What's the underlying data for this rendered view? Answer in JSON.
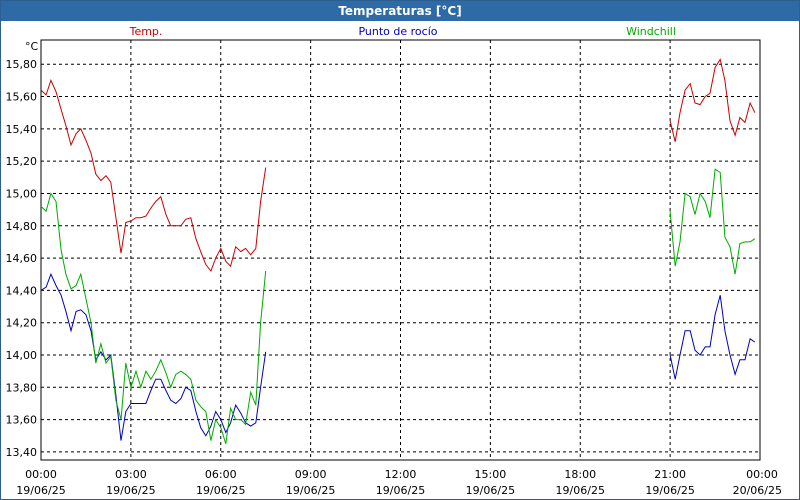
{
  "window": {
    "title": "Temperaturas [°C]"
  },
  "colors": {
    "temp": "#cc0000",
    "dew": "#0000bb",
    "wind": "#00aa00",
    "title_bg": "#2e6aa5"
  },
  "chart_data": {
    "type": "line",
    "title": "Temperaturas [°C]",
    "ylabel": "°C",
    "ylim": [
      13.35,
      15.95
    ],
    "xlim_hours": [
      0,
      24
    ],
    "grid": true,
    "legend_placement": "top",
    "y_ticks": [
      "13,40",
      "13,60",
      "13,80",
      "14,00",
      "14,20",
      "14,40",
      "14,60",
      "14,80",
      "15,00",
      "15,20",
      "15,40",
      "15,60",
      "15,80"
    ],
    "x_ticks": [
      {
        "time": "00:00",
        "date": "19/06/25"
      },
      {
        "time": "03:00",
        "date": "19/06/25"
      },
      {
        "time": "06:00",
        "date": "19/06/25"
      },
      {
        "time": "09:00",
        "date": "19/06/25"
      },
      {
        "time": "12:00",
        "date": "19/06/25"
      },
      {
        "time": "15:00",
        "date": "19/06/25"
      },
      {
        "time": "18:00",
        "date": "19/06/25"
      },
      {
        "time": "21:00",
        "date": "19/06/25"
      },
      {
        "time": "00:00",
        "date": "20/06/25"
      }
    ],
    "series": [
      {
        "name": "Temp.",
        "color": "#cc0000",
        "segments": [
          [
            [
              0.0,
              15.64
            ],
            [
              0.17,
              15.61
            ],
            [
              0.33,
              15.7
            ],
            [
              0.5,
              15.63
            ],
            [
              0.67,
              15.52
            ],
            [
              0.83,
              15.42
            ],
            [
              1.0,
              15.3
            ],
            [
              1.17,
              15.37
            ],
            [
              1.33,
              15.4
            ],
            [
              1.5,
              15.33
            ],
            [
              1.67,
              15.25
            ],
            [
              1.83,
              15.12
            ],
            [
              2.0,
              15.08
            ],
            [
              2.17,
              15.11
            ],
            [
              2.33,
              15.07
            ],
            [
              2.5,
              14.85
            ],
            [
              2.67,
              14.63
            ],
            [
              2.83,
              14.82
            ],
            [
              3.0,
              14.83
            ],
            [
              3.17,
              14.85
            ],
            [
              3.33,
              14.85
            ],
            [
              3.5,
              14.86
            ],
            [
              3.67,
              14.91
            ],
            [
              3.83,
              14.95
            ],
            [
              4.0,
              14.98
            ],
            [
              4.17,
              14.87
            ],
            [
              4.33,
              14.8
            ],
            [
              4.5,
              14.8
            ],
            [
              4.67,
              14.8
            ],
            [
              4.83,
              14.84
            ],
            [
              5.0,
              14.85
            ],
            [
              5.17,
              14.72
            ],
            [
              5.33,
              14.64
            ],
            [
              5.5,
              14.56
            ],
            [
              5.67,
              14.52
            ],
            [
              5.83,
              14.6
            ],
            [
              6.0,
              14.66
            ],
            [
              6.17,
              14.58
            ],
            [
              6.33,
              14.55
            ],
            [
              6.5,
              14.67
            ],
            [
              6.67,
              14.64
            ],
            [
              6.83,
              14.66
            ],
            [
              7.0,
              14.62
            ],
            [
              7.17,
              14.66
            ],
            [
              7.33,
              14.95
            ],
            [
              7.5,
              15.16
            ]
          ],
          [
            [
              21.0,
              15.45
            ],
            [
              21.17,
              15.32
            ],
            [
              21.33,
              15.5
            ],
            [
              21.5,
              15.64
            ],
            [
              21.67,
              15.68
            ],
            [
              21.83,
              15.56
            ],
            [
              22.0,
              15.55
            ],
            [
              22.17,
              15.6
            ],
            [
              22.33,
              15.62
            ],
            [
              22.5,
              15.78
            ],
            [
              22.67,
              15.83
            ],
            [
              22.83,
              15.7
            ],
            [
              23.0,
              15.45
            ],
            [
              23.17,
              15.36
            ],
            [
              23.33,
              15.47
            ],
            [
              23.5,
              15.44
            ],
            [
              23.67,
              15.56
            ],
            [
              23.83,
              15.5
            ]
          ]
        ]
      },
      {
        "name": "Punto de rocío",
        "color": "#0000bb",
        "segments": [
          [
            [
              0.0,
              14.4
            ],
            [
              0.17,
              14.42
            ],
            [
              0.33,
              14.5
            ],
            [
              0.5,
              14.43
            ],
            [
              0.67,
              14.37
            ],
            [
              0.83,
              14.27
            ],
            [
              1.0,
              14.15
            ],
            [
              1.17,
              14.27
            ],
            [
              1.33,
              14.28
            ],
            [
              1.5,
              14.25
            ],
            [
              1.67,
              14.15
            ],
            [
              1.83,
              13.97
            ],
            [
              2.0,
              14.02
            ],
            [
              2.17,
              13.97
            ],
            [
              2.33,
              14.0
            ],
            [
              2.5,
              13.75
            ],
            [
              2.67,
              13.47
            ],
            [
              2.83,
              13.65
            ],
            [
              3.0,
              13.7
            ],
            [
              3.17,
              13.7
            ],
            [
              3.33,
              13.7
            ],
            [
              3.5,
              13.7
            ],
            [
              3.67,
              13.78
            ],
            [
              3.83,
              13.85
            ],
            [
              4.0,
              13.85
            ],
            [
              4.17,
              13.78
            ],
            [
              4.33,
              13.72
            ],
            [
              4.5,
              13.7
            ],
            [
              4.67,
              13.73
            ],
            [
              4.83,
              13.8
            ],
            [
              5.0,
              13.78
            ],
            [
              5.17,
              13.65
            ],
            [
              5.33,
              13.55
            ],
            [
              5.5,
              13.5
            ],
            [
              5.67,
              13.56
            ],
            [
              5.83,
              13.65
            ],
            [
              6.0,
              13.6
            ],
            [
              6.17,
              13.52
            ],
            [
              6.33,
              13.58
            ],
            [
              6.5,
              13.69
            ],
            [
              6.67,
              13.64
            ],
            [
              6.83,
              13.58
            ],
            [
              7.0,
              13.56
            ],
            [
              7.17,
              13.58
            ],
            [
              7.33,
              13.8
            ],
            [
              7.5,
              14.02
            ]
          ],
          [
            [
              21.0,
              14.0
            ],
            [
              21.17,
              13.85
            ],
            [
              21.33,
              14.0
            ],
            [
              21.5,
              14.15
            ],
            [
              21.67,
              14.15
            ],
            [
              21.83,
              14.03
            ],
            [
              22.0,
              14.0
            ],
            [
              22.17,
              14.05
            ],
            [
              22.33,
              14.05
            ],
            [
              22.5,
              14.25
            ],
            [
              22.67,
              14.37
            ],
            [
              22.83,
              14.15
            ],
            [
              23.0,
              14.0
            ],
            [
              23.17,
              13.88
            ],
            [
              23.33,
              13.97
            ],
            [
              23.5,
              13.97
            ],
            [
              23.67,
              14.1
            ],
            [
              23.83,
              14.08
            ]
          ]
        ]
      },
      {
        "name": "Windchill",
        "color": "#00aa00",
        "segments": [
          [
            [
              0.0,
              14.92
            ],
            [
              0.17,
              14.89
            ],
            [
              0.33,
              15.0
            ],
            [
              0.5,
              14.95
            ],
            [
              0.67,
              14.65
            ],
            [
              0.83,
              14.5
            ],
            [
              1.0,
              14.41
            ],
            [
              1.17,
              14.43
            ],
            [
              1.33,
              14.5
            ],
            [
              1.5,
              14.35
            ],
            [
              1.67,
              14.2
            ],
            [
              1.83,
              13.95
            ],
            [
              2.0,
              14.07
            ],
            [
              2.17,
              13.95
            ],
            [
              2.33,
              13.99
            ],
            [
              2.5,
              13.72
            ],
            [
              2.67,
              13.6
            ],
            [
              2.83,
              13.95
            ],
            [
              3.0,
              13.8
            ],
            [
              3.17,
              13.9
            ],
            [
              3.33,
              13.8
            ],
            [
              3.5,
              13.9
            ],
            [
              3.67,
              13.85
            ],
            [
              3.83,
              13.9
            ],
            [
              4.0,
              13.97
            ],
            [
              4.17,
              13.89
            ],
            [
              4.33,
              13.8
            ],
            [
              4.5,
              13.88
            ],
            [
              4.67,
              13.9
            ],
            [
              4.83,
              13.88
            ],
            [
              5.0,
              13.85
            ],
            [
              5.17,
              13.72
            ],
            [
              5.33,
              13.68
            ],
            [
              5.5,
              13.65
            ],
            [
              5.67,
              13.47
            ],
            [
              5.83,
              13.6
            ],
            [
              6.0,
              13.55
            ],
            [
              6.17,
              13.45
            ],
            [
              6.33,
              13.67
            ],
            [
              6.5,
              13.6
            ],
            [
              6.67,
              13.6
            ],
            [
              6.83,
              13.57
            ],
            [
              7.0,
              13.77
            ],
            [
              7.17,
              13.69
            ],
            [
              7.33,
              14.2
            ],
            [
              7.5,
              14.52
            ]
          ],
          [
            [
              21.0,
              14.89
            ],
            [
              21.17,
              14.55
            ],
            [
              21.33,
              14.7
            ],
            [
              21.5,
              15.0
            ],
            [
              21.67,
              14.98
            ],
            [
              21.83,
              14.87
            ],
            [
              22.0,
              15.0
            ],
            [
              22.17,
              14.95
            ],
            [
              22.33,
              14.85
            ],
            [
              22.5,
              15.15
            ],
            [
              22.67,
              15.13
            ],
            [
              22.83,
              14.73
            ],
            [
              23.0,
              14.67
            ],
            [
              23.17,
              14.5
            ],
            [
              23.33,
              14.69
            ],
            [
              23.5,
              14.7
            ],
            [
              23.67,
              14.7
            ],
            [
              23.83,
              14.72
            ]
          ]
        ]
      }
    ]
  }
}
